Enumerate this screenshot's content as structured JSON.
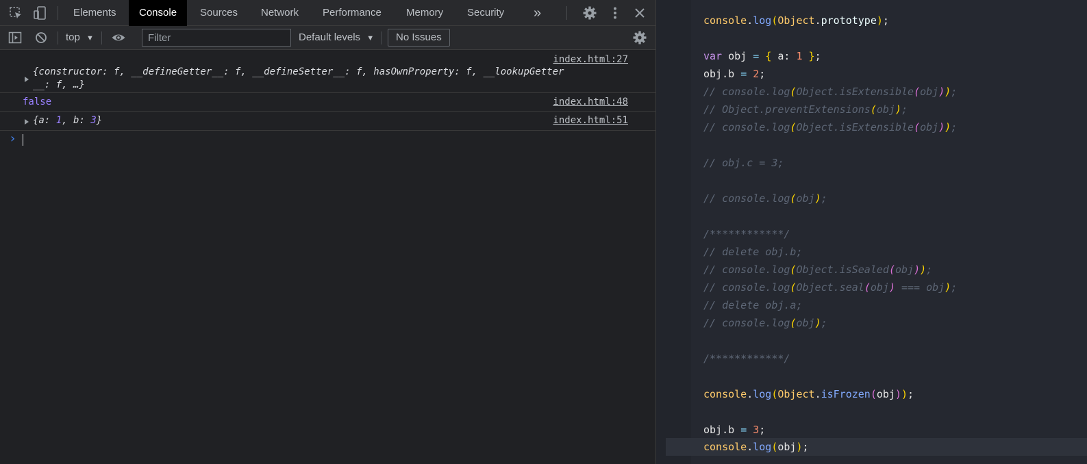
{
  "devtools": {
    "tabs": [
      "Elements",
      "Console",
      "Sources",
      "Network",
      "Performance",
      "Memory",
      "Security"
    ],
    "active_tab": "Console",
    "more_tabs_label": "»",
    "icons": [
      "inspect-element-icon",
      "device-toolbar-icon",
      "settings-gear-icon",
      "kebab-menu-icon",
      "close-icon"
    ]
  },
  "console_toolbar": {
    "context": "top",
    "filter_placeholder": "Filter",
    "levels": "Default levels",
    "issues": "No Issues"
  },
  "console_messages": [
    {
      "source": "index.html:27",
      "line1": "{constructor: f, __defineGetter__: f, __defineSetter__: f, hasOwnProperty: f, __lookupGetter",
      "line2": "__: f, …}"
    },
    {
      "source": "index.html:48",
      "text": "false"
    },
    {
      "source": "index.html:51",
      "open": "{a: ",
      "a_val": "1",
      "mid": ", b: ",
      "b_val": "3",
      "close": "}"
    }
  ],
  "prompt_symbol": "›",
  "editor": {
    "colors": {
      "comment": "#5d6675",
      "keyword": "#c792ea",
      "function": "#82aaff",
      "class": "#ffcb6b"
    },
    "lines": [
      {
        "text": "console.log(Object.prototype);"
      },
      {
        "text": ""
      },
      {
        "text": "var obj = { a: 1 };"
      },
      {
        "text": "obj.b = 2;"
      },
      {
        "text": "// console.log(Object.isExtensible(obj));"
      },
      {
        "text": "// Object.preventExtensions(obj);"
      },
      {
        "text": "// console.log(Object.isExtensible(obj));"
      },
      {
        "text": ""
      },
      {
        "text": "// obj.c = 3;"
      },
      {
        "text": ""
      },
      {
        "text": "// console.log(obj);"
      },
      {
        "text": ""
      },
      {
        "text": "/************/"
      },
      {
        "text": "// delete obj.b;"
      },
      {
        "text": "// console.log(Object.isSealed(obj));"
      },
      {
        "text": "// console.log(Object.seal(obj) === obj);"
      },
      {
        "text": "// delete obj.a;"
      },
      {
        "text": "// console.log(obj);"
      },
      {
        "text": ""
      },
      {
        "text": "/************/"
      },
      {
        "text": ""
      },
      {
        "text": "console.log(Object.isFrozen(obj));"
      },
      {
        "text": ""
      },
      {
        "text": "obj.b = 3;"
      },
      {
        "text": "console.log(obj);"
      }
    ]
  }
}
